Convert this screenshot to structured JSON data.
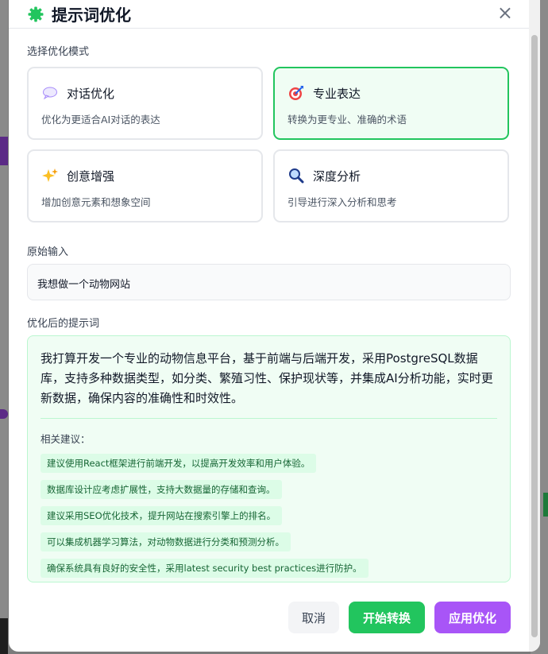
{
  "dialog": {
    "title": "提示词优化",
    "close_label": "×"
  },
  "modes": {
    "section_label": "选择优化模式",
    "items": [
      {
        "icon": "speech-bubble-icon",
        "title": "对话优化",
        "desc": "优化为更适合AI对话的表达",
        "active": false
      },
      {
        "icon": "target-icon",
        "title": "专业表达",
        "desc": "转换为更专业、准确的术语",
        "active": true
      },
      {
        "icon": "sparkles-icon",
        "title": "创意增强",
        "desc": "增加创意元素和想象空间",
        "active": false
      },
      {
        "icon": "magnifier-icon",
        "title": "深度分析",
        "desc": "引导进行深入分析和思考",
        "active": false
      }
    ]
  },
  "input": {
    "label": "原始输入",
    "value": "我想做一个动物网站"
  },
  "result": {
    "label": "优化后的提示词",
    "text": "我打算开发一个专业的动物信息平台，基于前端与后端开发，采用PostgreSQL数据库，支持多种数据类型，如分类、繁殖习性、保护现状等，并集成AI分析功能，实时更新数据，确保内容的准确性和时效性。",
    "suggest_label": "相关建议：",
    "suggestions": [
      "建议使用React框架进行前端开发，以提高开发效率和用户体验。",
      "数据库设计应考虑扩展性，支持大数据量的存储和查询。",
      "建议采用SEO优化技术，提升网站在搜索引擎上的排名。",
      "可以集成机器学习算法，对动物数据进行分类和预测分析。",
      "确保系统具有良好的安全性，采用latest security best practices进行防护。"
    ]
  },
  "buttons": {
    "cancel": "取消",
    "start": "开始转换",
    "apply": "应用优化"
  },
  "colors": {
    "accent_green": "#22c55e",
    "accent_purple": "#a855f7",
    "header_icon": "#22c55e"
  }
}
